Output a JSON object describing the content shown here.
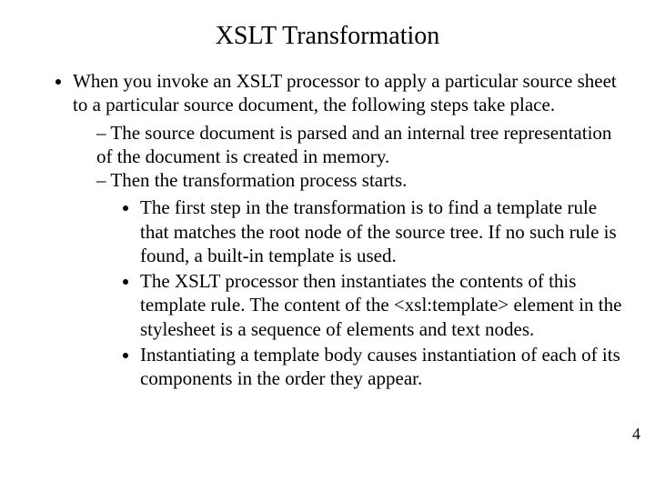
{
  "title": "XSLT Transformation",
  "bullets": {
    "b1": "When you invoke an XSLT processor to apply a particular source sheet to a particular source document, the following steps take place.",
    "b1_1": "The source document is parsed and an internal tree representation of the document is created in memory.",
    "b1_2": "Then the transformation process starts.",
    "b1_2_1": "The first step in the transformation is to find a template rule that matches the root node of the source tree. If no such rule is found, a built-in template is used.",
    "b1_2_2": "The XSLT processor then instantiates the contents of this template rule. The content of the <xsl:template> element in the stylesheet is a sequence of elements and text nodes.",
    "b1_2_3": "Instantiating a template body causes instantiation of each of its components in the order they appear."
  },
  "page_number": "4"
}
